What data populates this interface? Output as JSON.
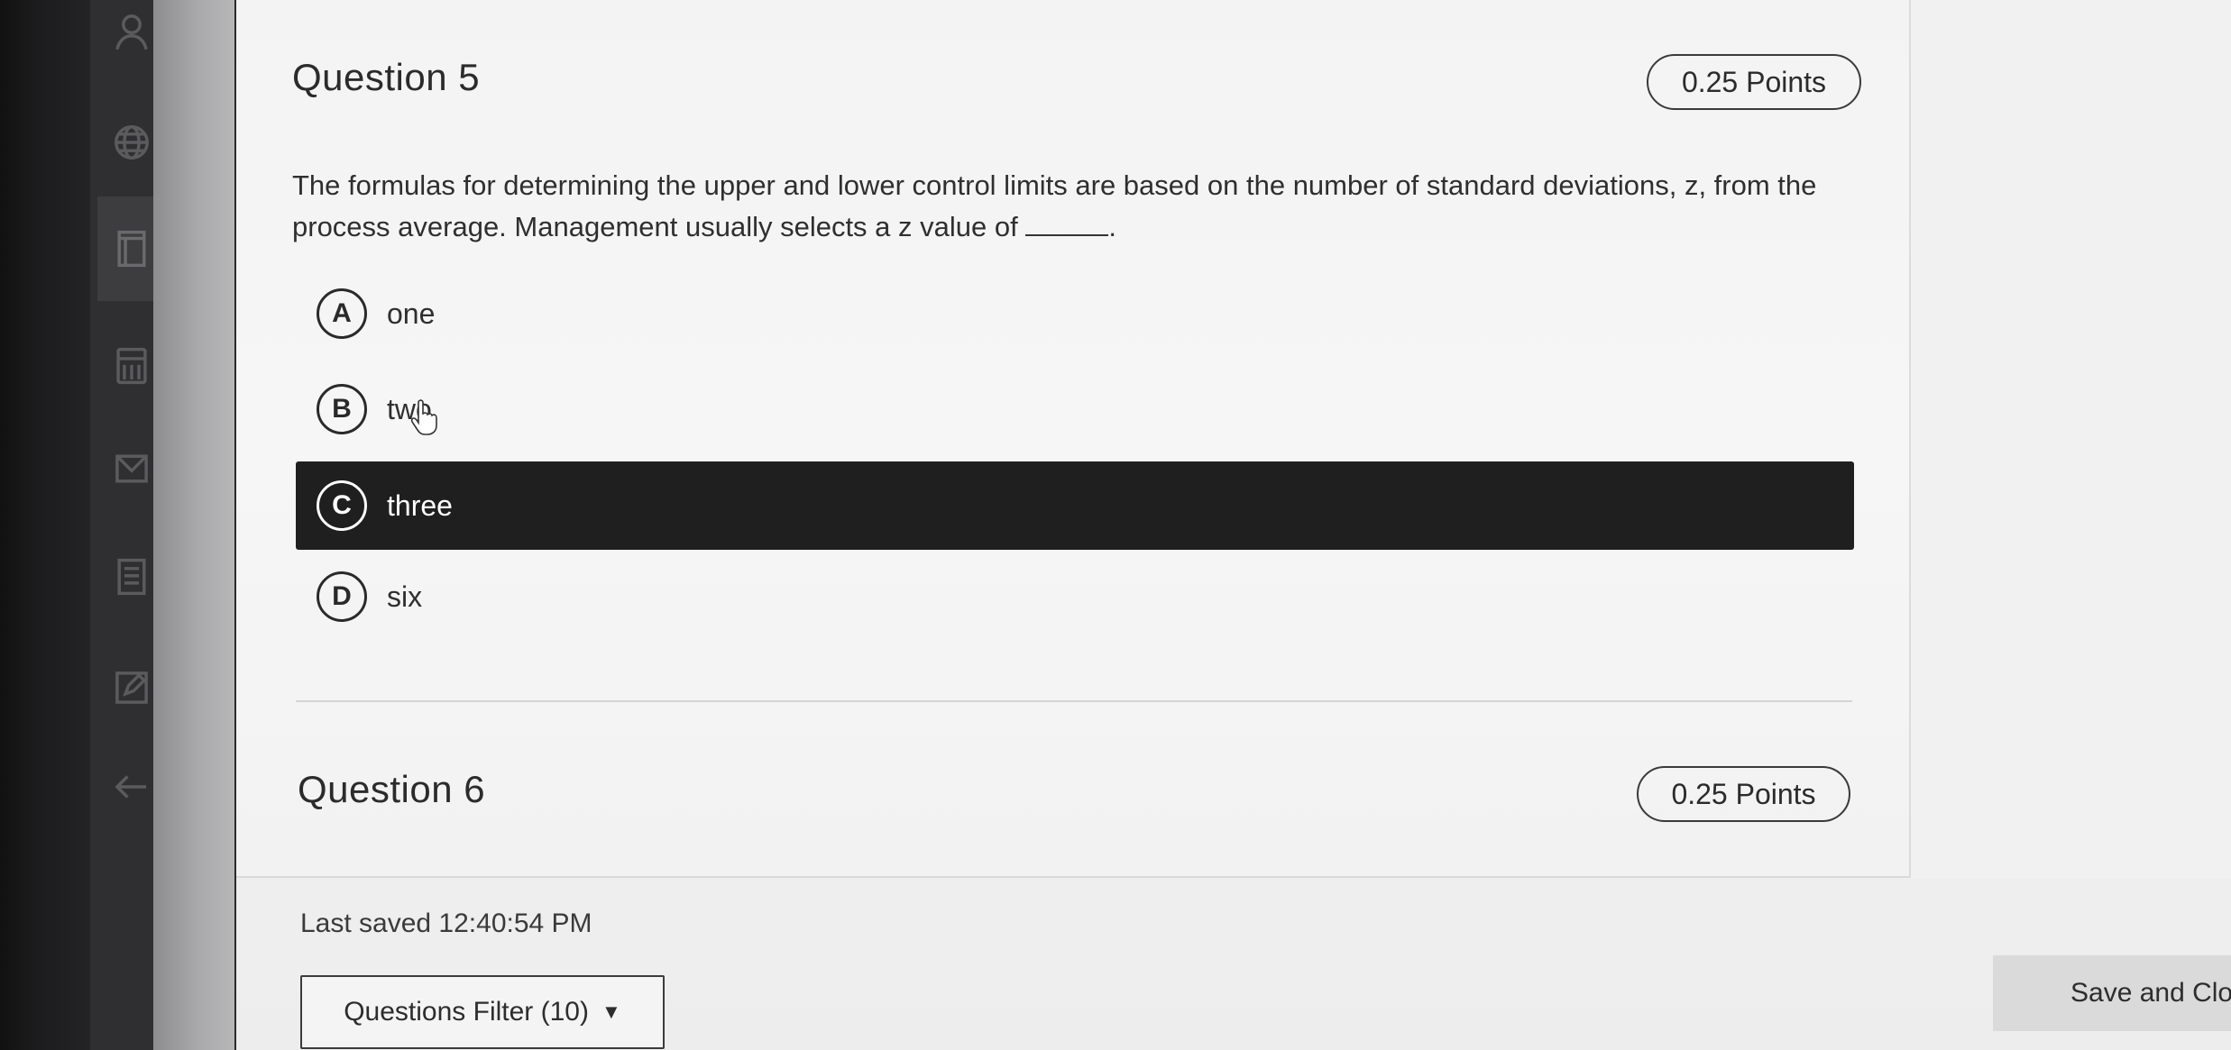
{
  "questions": [
    {
      "title": "Question 5",
      "points": "0.25 Points",
      "text_before_blank": "The formulas for determining the upper and lower control limits are based on the number of standard deviations, z, from the process average. Management usually selects a z value of",
      "text_after_blank": ".",
      "choices": [
        {
          "letter": "A",
          "label": "one",
          "selected": false
        },
        {
          "letter": "B",
          "label": "two",
          "selected": false
        },
        {
          "letter": "C",
          "label": "three",
          "selected": true
        },
        {
          "letter": "D",
          "label": "six",
          "selected": false
        }
      ]
    },
    {
      "title": "Question 6",
      "points": "0.25 Points"
    }
  ],
  "footer": {
    "last_saved": "Last saved 12:40:54 PM",
    "filter_label": "Questions Filter (10)",
    "save_label": "Save and Clo"
  },
  "sidebar_icons": [
    "user-icon",
    "globe-icon",
    "book-icon",
    "calculator-icon",
    "mail-icon",
    "notes-icon",
    "edit-icon",
    "back-arrow-icon"
  ],
  "colors": {
    "selected_choice_bg": "#1f1f20",
    "page_bg": "#f3f3f3",
    "text": "#2f2f2f"
  }
}
